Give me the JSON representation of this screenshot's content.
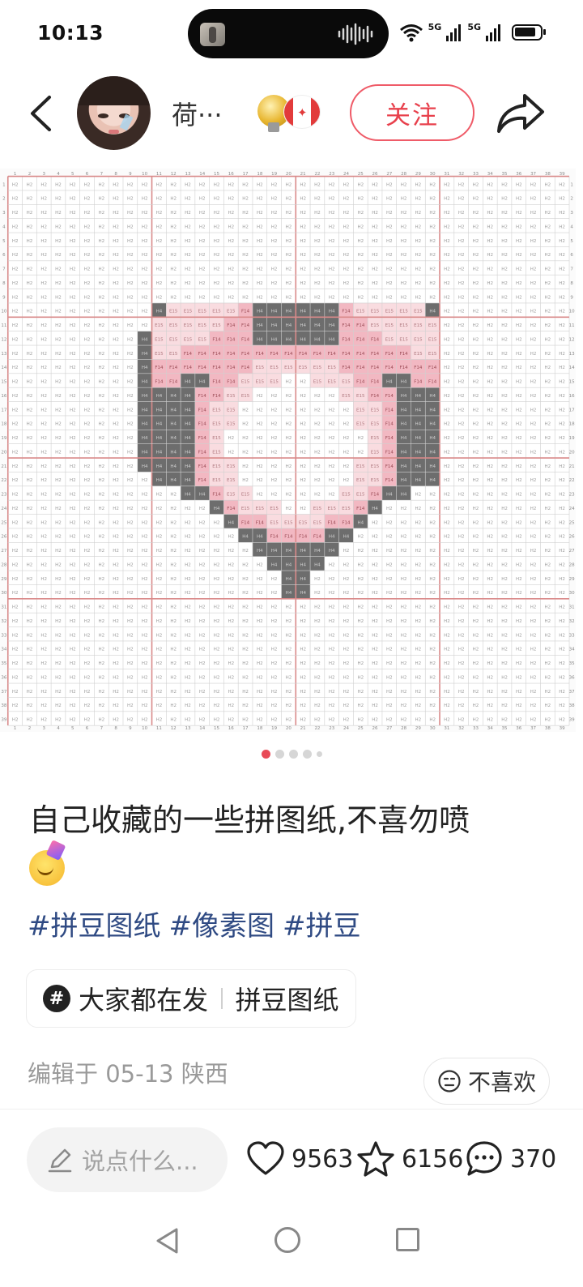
{
  "status_bar": {
    "time": "10:13",
    "network_1": "5G",
    "network_2": "5G",
    "icons": [
      "wifi-icon",
      "signal-icon",
      "signal-icon",
      "battery-icon"
    ]
  },
  "header": {
    "username": "荷···",
    "follow_label": "关注",
    "badges": [
      "medal-badge-icon",
      "canada-flag-icon"
    ]
  },
  "pattern_image": {
    "rows": 39,
    "cols": 39,
    "cell_code": "H2",
    "pink_code": "F14",
    "light_code": "E15",
    "dark_code": "H4",
    "accent_colors": {
      "grid_line": "#d98a8a",
      "dark": "#6d6d6d",
      "pink": "#f2b8c2",
      "light_pink": "#f9dce0"
    }
  },
  "pagination": {
    "count": 5,
    "active": 0
  },
  "post": {
    "title": "自己收藏的一些拼图纸,不喜勿喷",
    "emoji": "partying-face-emoji",
    "tags": [
      "#拼豆图纸",
      "#像素图",
      "#拼豆"
    ],
    "topic_chip": {
      "left": "大家都在发",
      "right": "拼豆图纸"
    },
    "edit_info": "编辑于 05-13 陕西",
    "dislike_label": "不喜欢"
  },
  "bottom_bar": {
    "comment_placeholder": "说点什么...",
    "likes": "9563",
    "favorites": "6156",
    "comments": "370"
  },
  "colors": {
    "accent": "#e8404c",
    "tag": "#2f4a83"
  }
}
